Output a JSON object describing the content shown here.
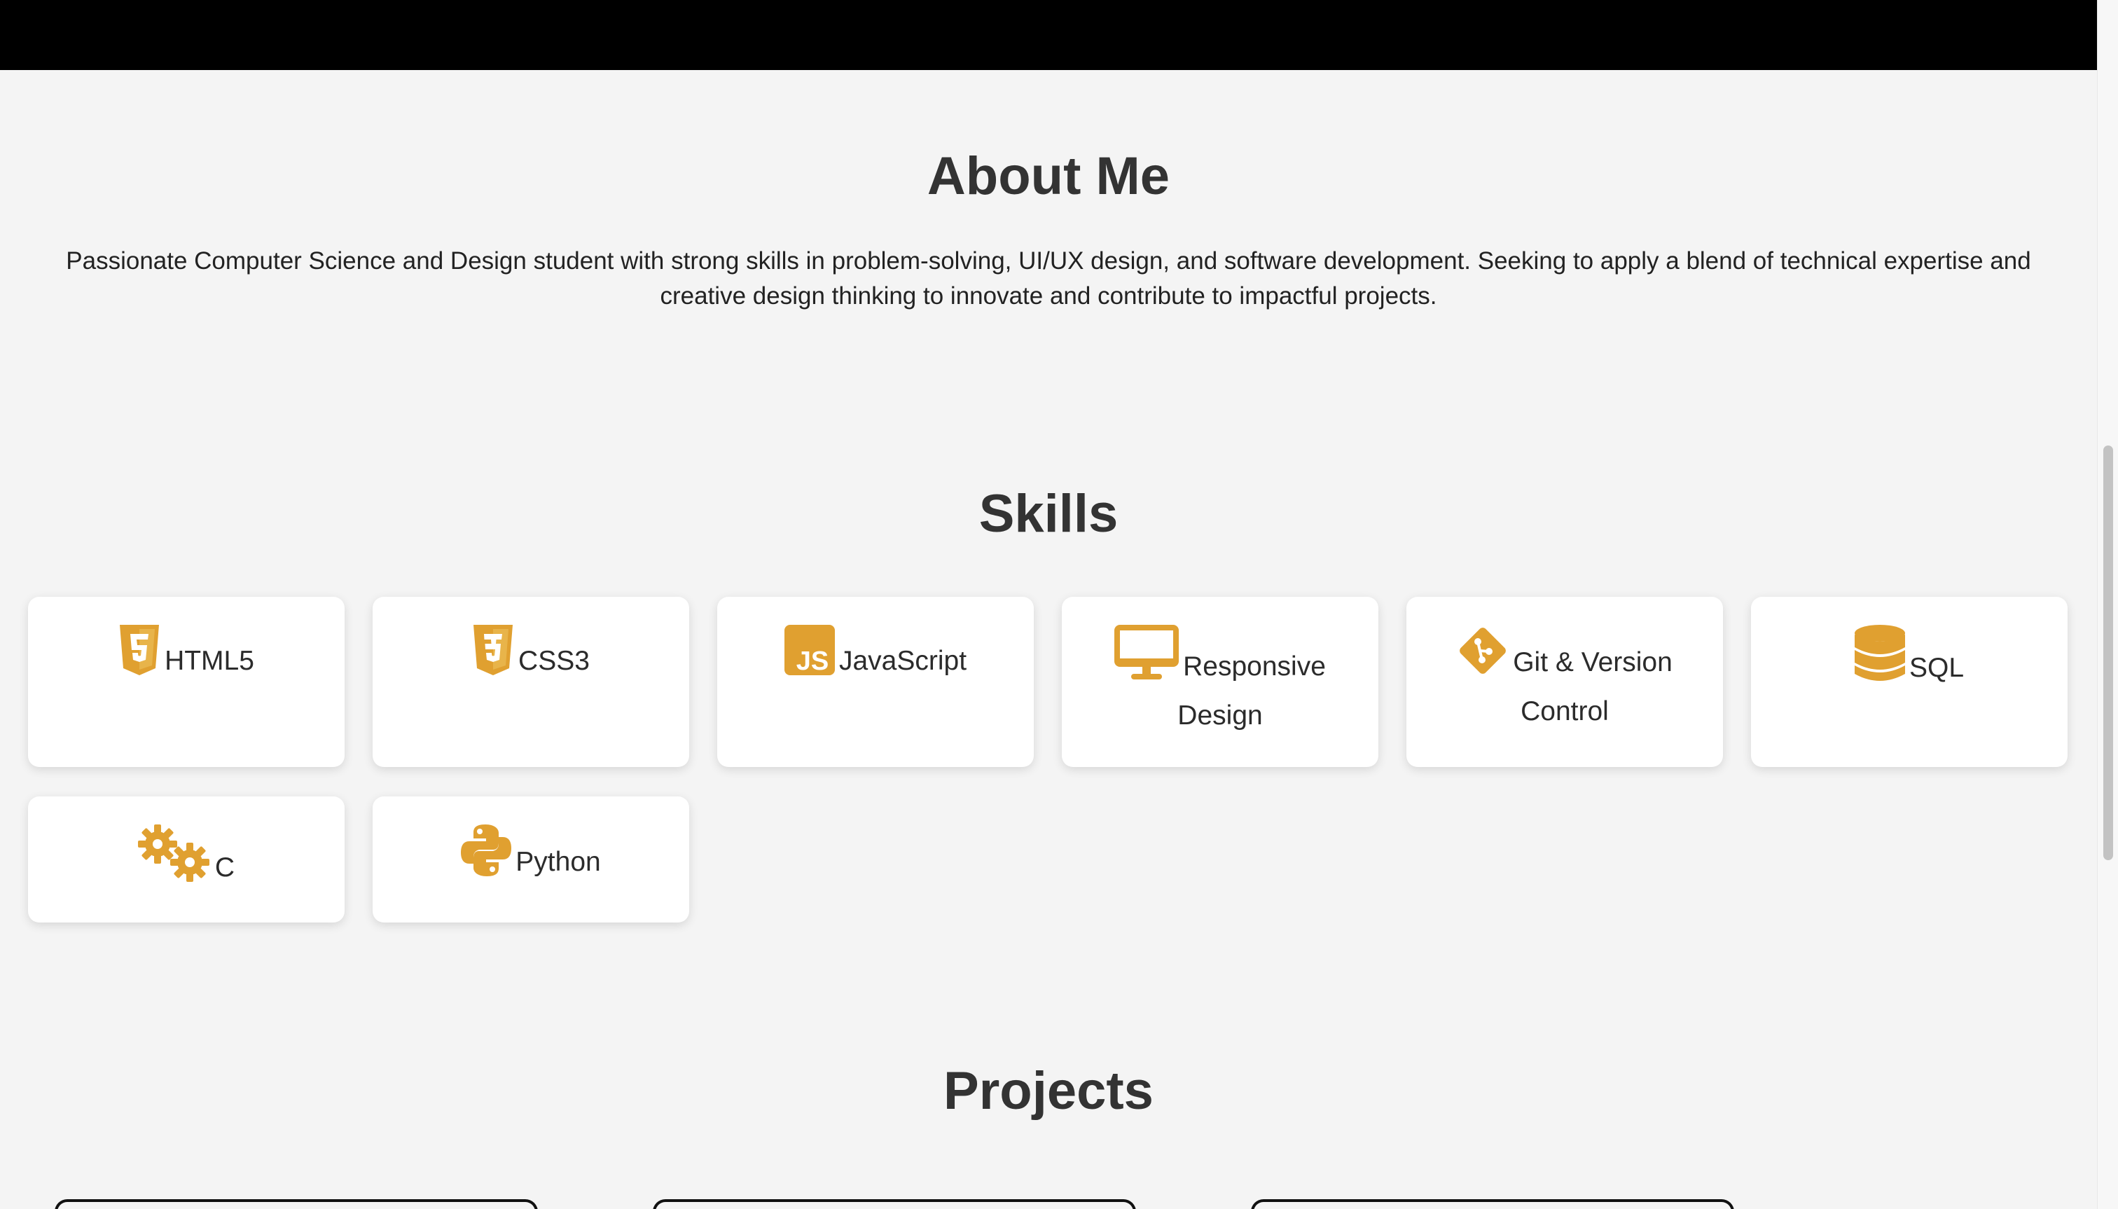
{
  "colors": {
    "accent": "#e0a030",
    "background": "#f4f4f4",
    "card": "#ffffff",
    "header_bar": "#000000",
    "text": "#333333"
  },
  "about": {
    "title": "About Me",
    "text": "Passionate Computer Science and Design student with strong skills in problem-solving, UI/UX design, and software development. Seeking to apply a blend of technical expertise and creative design thinking to innovate and contribute to impactful projects."
  },
  "skills": {
    "title": "Skills",
    "items": [
      {
        "label": "HTML5",
        "icon": "html5-icon"
      },
      {
        "label": "CSS3",
        "icon": "css3-icon"
      },
      {
        "label": "JavaScript",
        "icon": "javascript-icon"
      },
      {
        "label": "Responsive Design",
        "icon": "desktop-icon"
      },
      {
        "label": "Git & Version Control",
        "icon": "git-icon"
      },
      {
        "label": "SQL",
        "icon": "database-icon"
      },
      {
        "label": "C",
        "icon": "gears-icon"
      },
      {
        "label": "Python",
        "icon": "python-icon"
      }
    ]
  },
  "projects": {
    "title": "Projects"
  }
}
